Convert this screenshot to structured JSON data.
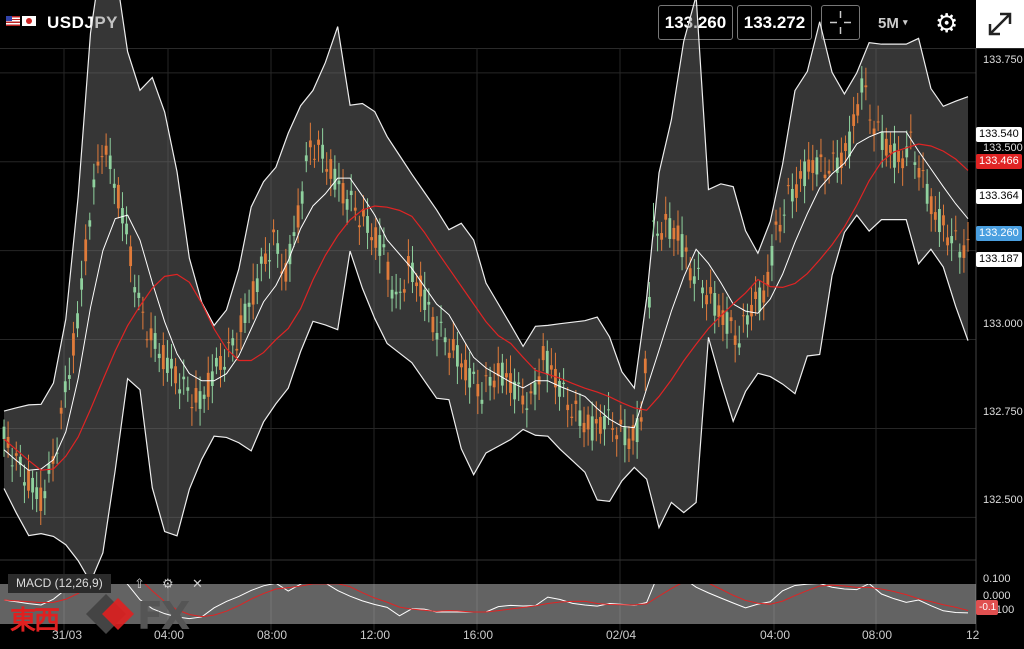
{
  "header": {
    "symbol": "USDJPY",
    "bid": "133.260",
    "ask": "133.272",
    "timeframe": "5M",
    "icons": [
      "us-flag-icon",
      "jp-flag-icon",
      "crosshair-icon",
      "gear-icon",
      "expand-icon"
    ]
  },
  "axis": {
    "price_labels": [
      "133.750",
      "133.500",
      "133.000",
      "132.750",
      "132.500"
    ],
    "macd_labels": [
      "0.100",
      "0.000",
      "-0.100"
    ],
    "time_labels": [
      "31/03",
      "04:00",
      "08:00",
      "12:00",
      "16:00",
      "02/04",
      "04:00",
      "08:00",
      "12"
    ]
  },
  "tags": {
    "upper_band": "133.540",
    "ma": "133.466",
    "middle_band": "133.364",
    "last": "133.260",
    "lower_band": "133.187",
    "macd_value": "-0.1"
  },
  "macd": {
    "label": "MACD (12,26,9)",
    "tools": [
      "arrow-up-icon",
      "gear-icon",
      "close-icon"
    ]
  },
  "logo": {
    "kanji": "東西",
    "fx": "FX"
  },
  "colors": {
    "up": "#8fd19e",
    "down": "#e07b3a",
    "ma": "#e02424",
    "band": "#ffffff",
    "last_tag": "#4a9fe0"
  },
  "chart_data": {
    "type": "line",
    "series": [
      {
        "values": [
          132.72,
          132.66,
          132.6,
          132.55,
          132.65,
          132.85,
          133.05,
          133.35,
          133.55,
          133.45,
          133.3,
          133.1,
          133.0,
          132.95,
          132.9,
          132.85,
          132.82,
          132.9,
          132.95,
          133.0,
          133.1,
          133.2,
          133.28,
          133.18,
          133.35,
          133.55,
          133.52,
          133.45,
          133.4,
          133.35,
          133.3,
          133.25,
          133.1,
          133.2,
          133.15,
          133.05,
          133.0,
          132.95,
          132.9,
          132.85,
          132.9,
          132.9,
          132.85,
          132.82,
          132.95,
          132.9,
          132.82,
          132.78,
          132.75,
          132.78,
          132.75,
          132.72,
          132.76,
          133.3,
          133.32,
          133.3,
          133.2,
          133.15,
          133.1,
          133.05,
          133.0,
          133.1,
          133.12,
          133.3,
          133.4,
          133.45,
          133.5,
          133.48,
          133.5,
          133.55,
          133.72,
          133.6,
          133.55,
          133.5,
          133.55,
          133.45,
          133.35,
          133.3,
          133.26
        ]
      }
    ],
    "ylim": [
      132.38,
      133.82
    ]
  }
}
